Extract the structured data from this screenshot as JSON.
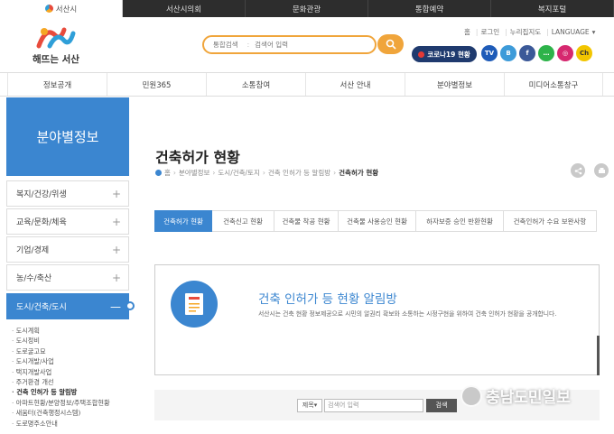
{
  "topbar": [
    "서산시",
    "서산시의회",
    "문화관광",
    "통합예약",
    "복지포털"
  ],
  "logo": {
    "text": "해뜨는 서산"
  },
  "search": {
    "label": "통합검색",
    "placeholder": "검색어 입력"
  },
  "util": [
    "홈",
    "로그인",
    "누리집지도",
    "LANGUAGE"
  ],
  "covid_button": "코로나19 현황",
  "sns": [
    "서산TV",
    "블로그",
    "f",
    "카카오",
    "인스타",
    "Ch"
  ],
  "gnb": [
    "정보공개",
    "민원365",
    "소통참여",
    "서산 안내",
    "분야별정보",
    "미디어소통창구"
  ],
  "lnb": {
    "title": "분야별정보",
    "items": [
      {
        "label": "복지/건강/위생",
        "active": false
      },
      {
        "label": "교육/문화/체육",
        "active": false
      },
      {
        "label": "기업/경제",
        "active": false
      },
      {
        "label": "농/수/축산",
        "active": false
      },
      {
        "label": "도시/건축/도시",
        "active": true
      }
    ],
    "sub": [
      "도시계획",
      "도시정비",
      "도로굴고묘",
      "도시개발/사업",
      "택지개발사업",
      "주거환경 개선",
      "건축 인허가 등 알림방",
      "아파트현황/분양정보/주택조합현황",
      "새움터(건축행정시스템)",
      "도로명주소안내"
    ]
  },
  "page": {
    "title": "건축허가 현황",
    "breadcrumb": [
      "홈",
      "분야별정보",
      "도시/건축/토지",
      "건축 인허가 등 알림방",
      "건축허가 현황"
    ]
  },
  "tabs": [
    {
      "label": "건축허가 현황",
      "active": true
    },
    {
      "label": "건축신고 현황",
      "active": false
    },
    {
      "label": "건축물 착공 현황",
      "active": false
    },
    {
      "label": "건축물 사용승인 현황",
      "active": false
    },
    {
      "label": "하자보증 승인 반환현황",
      "active": false
    },
    {
      "label": "건축인허가 수요 보완사항",
      "active": false
    }
  ],
  "info": {
    "title": "건축 인허가 등 현황 알림방",
    "desc": "서산시는 건축 현황 정보제공으로 시민의 알권리 확보와 소통하는 시정구현을 위하여 건축 인허가 현황을 공개합니다."
  },
  "board_search": {
    "select": "제목",
    "placeholder": "검색어 입력",
    "button": "검색"
  },
  "watermark": "충남도민일보",
  "colors": {
    "accent": "#3b86d0",
    "search_border": "#f0a53b",
    "covid": "#1f3a6e"
  }
}
